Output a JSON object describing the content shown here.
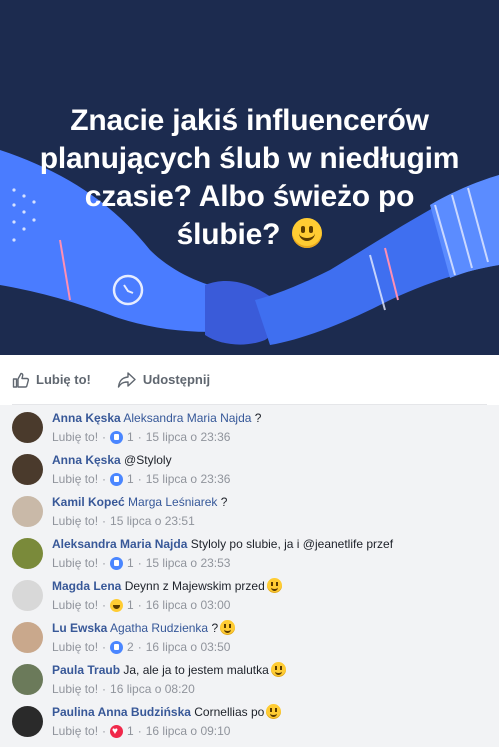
{
  "hero": {
    "line1": "Znacie jakiś influencerów",
    "line2": "planujących ślub w niedługim",
    "line3": "czasie? Albo świeżo po",
    "line4": "ślubie?",
    "colors": {
      "background": "#1c2b4f",
      "arm": "#4a7cff",
      "hand": "#3a5bd9"
    }
  },
  "actions": {
    "like_label": "Lubię to!",
    "share_label": "Udostępnij"
  },
  "comments": [
    {
      "author": "Anna Kęska",
      "tag": "Aleksandra Maria Najda",
      "text": " ?",
      "like": "Lubię to!",
      "reaction": "like",
      "count": "1",
      "time": "15 lipca o 23:36",
      "avatar": "#4a3a2c"
    },
    {
      "author": "Anna Kęska",
      "tag": "",
      "text": "@Styloly",
      "like": "Lubię to!",
      "reaction": "like",
      "count": "1",
      "time": "15 lipca o 23:36",
      "avatar": "#4a3a2c"
    },
    {
      "author": "Kamil Kopeć",
      "tag": "Marga Leśniarek",
      "text": " ?",
      "like": "Lubię to!",
      "reaction": "",
      "count": "",
      "time": "15 lipca o 23:51",
      "avatar": "#c9b9a8"
    },
    {
      "author": "Aleksandra Maria Najda",
      "tag": "",
      "text": "Styloly po slubie, ja i @jeanetlife przef",
      "like": "Lubię to!",
      "reaction": "like",
      "count": "1",
      "time": "15 lipca o 23:53",
      "avatar": "#7a8a3a"
    },
    {
      "author": "Magda Lena",
      "tag": "",
      "text": "Deynn z Majewskim przed",
      "emoji": true,
      "like": "Lubię to!",
      "reaction": "haha",
      "count": "1",
      "time": "16 lipca o 03:00",
      "avatar": "#d8d8d8"
    },
    {
      "author": "Lu Ewska",
      "tag": "Agatha Rudzienka",
      "text": "?",
      "emoji": true,
      "like": "Lubię to!",
      "reaction": "like",
      "count": "2",
      "time": "16 lipca o 03:50",
      "avatar": "#c9a88c"
    },
    {
      "author": "Paula Traub",
      "tag": "",
      "text": "Ja, ale ja to jestem malutka",
      "emoji": true,
      "like": "Lubię to!",
      "reaction": "",
      "count": "",
      "time": "16 lipca o 08:20",
      "avatar": "#6b7a5a"
    },
    {
      "author": "Paulina Anna Budzińska",
      "tag": "",
      "text": "Cornellias po",
      "emoji": true,
      "like": "Lubię to!",
      "reaction": "love",
      "count": "1",
      "time": "16 lipca o 09:10",
      "avatar": "#2a2a2a"
    }
  ]
}
